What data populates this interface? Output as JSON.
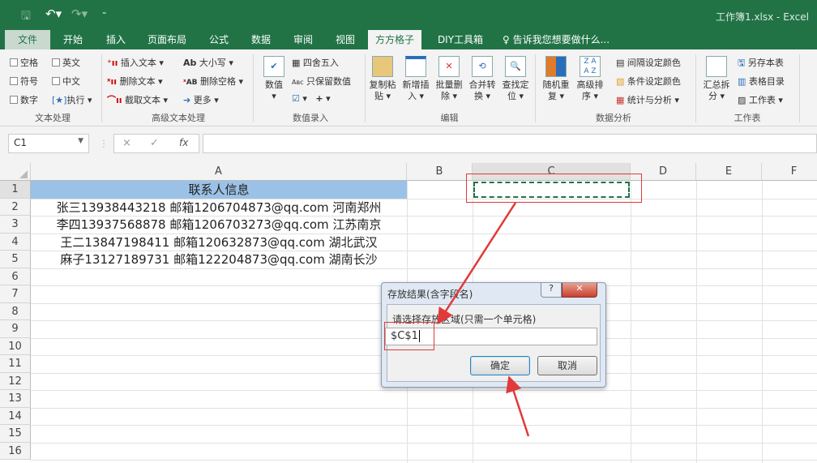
{
  "window": {
    "title": "工作簿1.xlsx - Excel"
  },
  "qat": {
    "save": "save-icon",
    "undo": "undo-icon",
    "redo": "redo-icon",
    "customize": "customize-icon"
  },
  "tabs": [
    "文件",
    "开始",
    "插入",
    "页面布局",
    "公式",
    "数据",
    "审阅",
    "视图",
    "方方格子",
    "DIY工具箱"
  ],
  "tell_me": "告诉我您想要做什么...",
  "ribbon": {
    "text_processing": {
      "items": [
        "空格",
        "英文",
        "符号",
        "中文",
        "数字",
        "执行"
      ],
      "label": "文本处理"
    },
    "advanced_text": {
      "items": [
        "插入文本",
        "大小写",
        "删除文本",
        "删除空格",
        "截取文本",
        "更多"
      ],
      "label": "高级文本处理"
    },
    "numeric_entry": {
      "big": "数值",
      "items": [
        "四舍五入",
        "只保留数值"
      ],
      "label": "数值录入"
    },
    "edit": {
      "buttons": [
        [
          "复制粘",
          "贴"
        ],
        [
          "新增插",
          "入"
        ],
        [
          "批量删",
          "除"
        ],
        [
          "合并转",
          "换"
        ],
        [
          "查找定",
          "位"
        ]
      ],
      "label": "编辑"
    },
    "data_analysis": {
      "buttons": [
        [
          "随机重",
          "复"
        ],
        [
          "高级排",
          "序"
        ]
      ],
      "items": [
        "间隔设定颜色",
        "条件设定颜色",
        "统计与分析"
      ],
      "label": "数据分析"
    },
    "worksheet": {
      "buttons": [
        [
          "汇总拆",
          "分"
        ]
      ],
      "items": [
        "另存本表",
        "表格目录",
        "工作表"
      ],
      "label": "工作表"
    }
  },
  "formula_bar": {
    "name_box": "C1",
    "cancel": "×",
    "enter": "✓",
    "fx": "fx",
    "value": ""
  },
  "sheet": {
    "columns": [
      "A",
      "B",
      "C",
      "D",
      "E",
      "F"
    ],
    "rows": [
      "1",
      "2",
      "3",
      "4",
      "5",
      "6",
      "7",
      "8",
      "9",
      "10",
      "11",
      "12",
      "13",
      "14",
      "15",
      "16"
    ],
    "cells": [
      "联系人信息",
      "张三13938443218 邮箱1206704873@qq.com 河南郑州",
      "李四13937568878 邮箱1206703273@qq.com 江苏南京",
      "王二13847198411 邮箱120632873@qq.com 湖北武汉",
      "麻子13127189731 邮箱122204873@qq.com 湖南长沙"
    ]
  },
  "dialog": {
    "title": "存放结果(含字段名)",
    "help": "?",
    "close": "✕",
    "label": "请选择存放区域(只需一个单元格)",
    "input_value": "$C$1",
    "ok": "确定",
    "cancel": "取消"
  },
  "colors": {
    "accent": "#217346",
    "header_fill": "#9bc2e6",
    "annotation": "#e03a3a"
  }
}
